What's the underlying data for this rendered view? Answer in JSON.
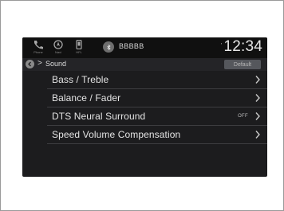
{
  "statusbar": {
    "icons": [
      {
        "name": "phone-icon",
        "label": "Phone"
      },
      {
        "name": "navigation-icon",
        "label": "Navi"
      },
      {
        "name": "hfl-icon",
        "label": "HFL"
      }
    ],
    "source_name": "BBBBB",
    "signal": "'",
    "clock": "12:34"
  },
  "navbar": {
    "breadcrumb_arrow": ">",
    "title": "Sound",
    "default_label": "Default"
  },
  "menu": {
    "items": [
      {
        "label": "Bass / Treble",
        "value": ""
      },
      {
        "label": "Balance / Fader",
        "value": ""
      },
      {
        "label": "DTS Neural Surround",
        "value": "OFF"
      },
      {
        "label": "Speed Volume Compensation",
        "value": ""
      }
    ]
  },
  "colors": {
    "screen_bg": "#1c1c1e",
    "status_bg": "#101010",
    "text": "#e4e4e4",
    "divider": "#3d3d40"
  }
}
